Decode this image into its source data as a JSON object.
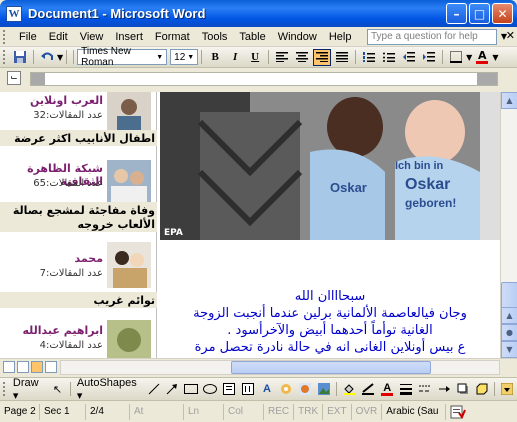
{
  "window": {
    "title": "Document1 - Microsoft Word",
    "icon_letter": "W"
  },
  "menu": {
    "items": [
      "File",
      "Edit",
      "View",
      "Insert",
      "Format",
      "Tools",
      "Table",
      "Window",
      "Help"
    ],
    "help_placeholder": "Type a question for help"
  },
  "toolbar": {
    "font_name": "Times New Roman",
    "font_size": "12",
    "bold": "B",
    "italic": "I",
    "underline": "U",
    "font_color_label": "A"
  },
  "sidebar": {
    "items": [
      {
        "name": "العرب اونلاين",
        "count": "عدد المقالات:32",
        "title": "اطفال الأنابيب اكثر عرضة"
      },
      {
        "name": "شبكة الظاهرة الثقافية",
        "count": "عدد المقالات:65",
        "title": "وفاة مفاجئة لمشجع بصالة الألعاب خروجه"
      },
      {
        "name": "محمد",
        "count": "عدد المقالات:7",
        "title": "توائم غريب"
      },
      {
        "name": "ابراهيم عبدالله",
        "count": "عدد المقالات:4",
        "title": ""
      }
    ]
  },
  "photo": {
    "caption": "EPA",
    "label1": "Ich bin in",
    "label2": "Oskar",
    "label3": "geboren!"
  },
  "article": {
    "lines": [
      "سبحاااان الله",
      "وجان فيالعاصمة الألمانية برلين عندما أنجبت الزوجة",
      "الغانية توأماً أحدهما أبيض والآخرأسود .",
      "ع بيس أونلاين الغانى انه في حالة نادرة تحصل مرة"
    ]
  },
  "drawbar": {
    "draw_label": "Draw",
    "autoshapes_label": "AutoShapes"
  },
  "status": {
    "page": "Page 2",
    "sec": "Sec 1",
    "pages": "2/4",
    "at": "At",
    "ln": "Ln",
    "col": "Col",
    "rec": "REC",
    "trk": "TRK",
    "ext": "EXT",
    "ovr": "OVR",
    "language": "Arabic (Sau"
  }
}
